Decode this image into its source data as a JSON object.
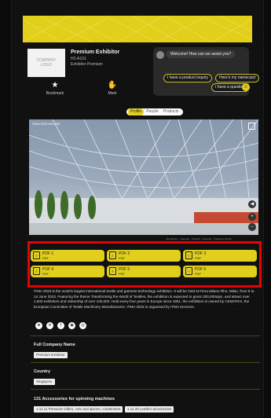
{
  "exhibitor": {
    "logo_text": "COMPANY\nLOGO",
    "name": "Premium Exhibitor",
    "hall": "H2-A101",
    "tier": "Exhibitor Premium"
  },
  "chat": {
    "greeting": "Welcome! How can we assist you?",
    "quick_replies": [
      "I have a product inquiry",
      "Here's my namecard",
      "I have a question"
    ],
    "user_avatar": "user-icon"
  },
  "actions": {
    "bookmark": "Bookmark",
    "meet": "Meet"
  },
  "tabs": [
    "Profile",
    "People",
    "Products"
  ],
  "active_tab": "Profile",
  "video": {
    "title": "ITMA 2023 MILANO"
  },
  "video_strip": [
    "Introduction",
    "Scenario",
    "Process",
    "Lifecycle",
    "Customer Stories"
  ],
  "pdfs": [
    {
      "label": "PDF 1",
      "type": "PDF"
    },
    {
      "label": "PDF 2",
      "type": "PDF"
    },
    {
      "label": "PDF 3",
      "type": "PDF"
    },
    {
      "label": "PDF 4",
      "type": "PDF"
    },
    {
      "label": "PDF 5",
      "type": "PDF"
    },
    {
      "label": "PDF 6",
      "type": "PDF"
    }
  ],
  "description": "ITMA 2023 is the world's largest international textile and garment technology exhibition. It will be held at Fiera Milano Rho, Milan, from 8 to 14 June 2023. Featuring the theme Transforming the World of Textiles, the exhibition is expected to gross 200,000sqm, and attract over 1,500 exhibitors and visitorship of over 100,000. Held every four years in Europe since 1951, the exhibition is owned by CEMATEX, the European Committee of Textile Machinery Manufacturers. ITMA 2023 is organised by ITMA Services.",
  "social_icons": [
    "globe-icon",
    "linkedin-icon",
    "facebook-icon",
    "wechat-icon",
    "instagram-icon"
  ],
  "sections": {
    "full_company_name": {
      "title": "Full Company Name",
      "value": "Premium Exhibitor"
    },
    "country": {
      "title": "Country",
      "value": "Singapore"
    },
    "category": {
      "title": "131 Accessories for spinning machines",
      "tags": [
        "1.11.11 Pressure rollers, cots and aprons, condensers",
        "1.11.20 Leather accessories"
      ]
    }
  },
  "colors": {
    "accent": "#e2cf1b",
    "highlight": "#e60000",
    "background": "#111111"
  }
}
